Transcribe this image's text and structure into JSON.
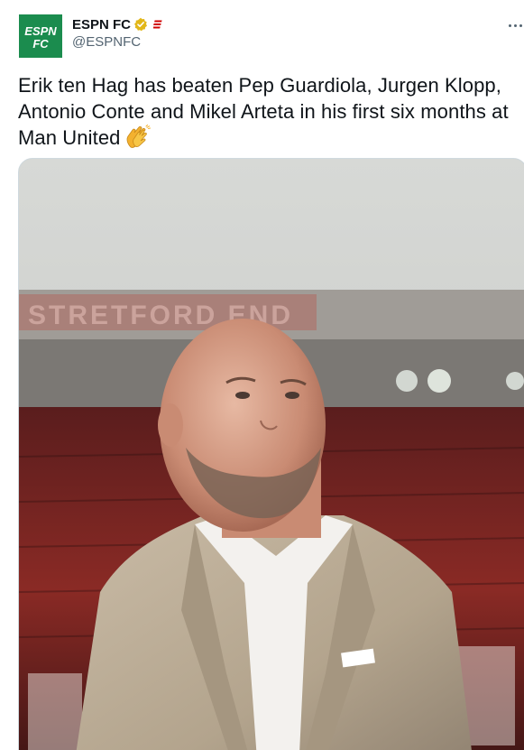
{
  "account": {
    "display_name": "ESPN FC",
    "handle": "@ESPNFC",
    "avatar_text_top": "ESPN",
    "avatar_text_bottom": "FC",
    "avatar_color": "#1b8c4e",
    "verified_color": "#e2b719",
    "label_color": "#d00000"
  },
  "tweet": {
    "text": "Erik ten Hag has beaten Pep Guardiola, Jurgen Klopp, Antonio Conte and Mikel Arteta in his first six months at Man United",
    "emoji": "clapping-hands-icon"
  },
  "media": {
    "stadium_sign": "STRETFORD END"
  },
  "colors": {
    "text": "#0f1419",
    "secondary": "#536471",
    "border": "#cfd9de"
  }
}
